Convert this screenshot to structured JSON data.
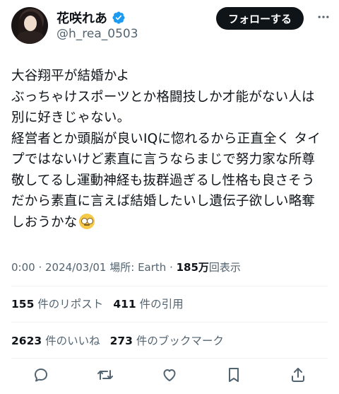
{
  "header": {
    "display_name": "花咲れあ",
    "handle": "@h_rea_0503",
    "follow_label": "フォローする",
    "verified_color": "#1d9bf0"
  },
  "tweet": {
    "lines": [
      "大谷翔平が結婚かよ",
      "ぶっちゃけスポーツとか格闘技しか才能がない人は",
      "別に好きじゃない。",
      "経営者とか頭脳が良いIQに惚れるから正直全く タイ",
      "プではないけど素直に言うならまじで努力家な所尊",
      "敬してるし運動神経も抜群過ぎるし性格も良さそう",
      "だから素直に言えば結婚したいし遺伝子欲しい略奪",
      "しおうかな"
    ],
    "emoji": "face-with-rolling-eyes"
  },
  "meta": {
    "time": "0:00",
    "date": "2024/03/01",
    "location_label": "場所: Earth",
    "separator": " · ",
    "views_count": "185万",
    "views_label": "回表示"
  },
  "stats": {
    "reposts_count": "155",
    "reposts_label": "件のリポスト",
    "quotes_count": "411",
    "quotes_label": "件の引用",
    "likes_count": "2623",
    "likes_label": "件のいいね",
    "bookmarks_count": "273",
    "bookmarks_label": "件のブックマーク"
  },
  "actions": [
    "reply-icon",
    "repost-icon",
    "like-icon",
    "bookmark-icon",
    "share-icon"
  ],
  "colors": {
    "text_primary": "#0f1419",
    "text_secondary": "#536471",
    "divider": "#eff3f4",
    "button_bg": "#0f1419"
  }
}
